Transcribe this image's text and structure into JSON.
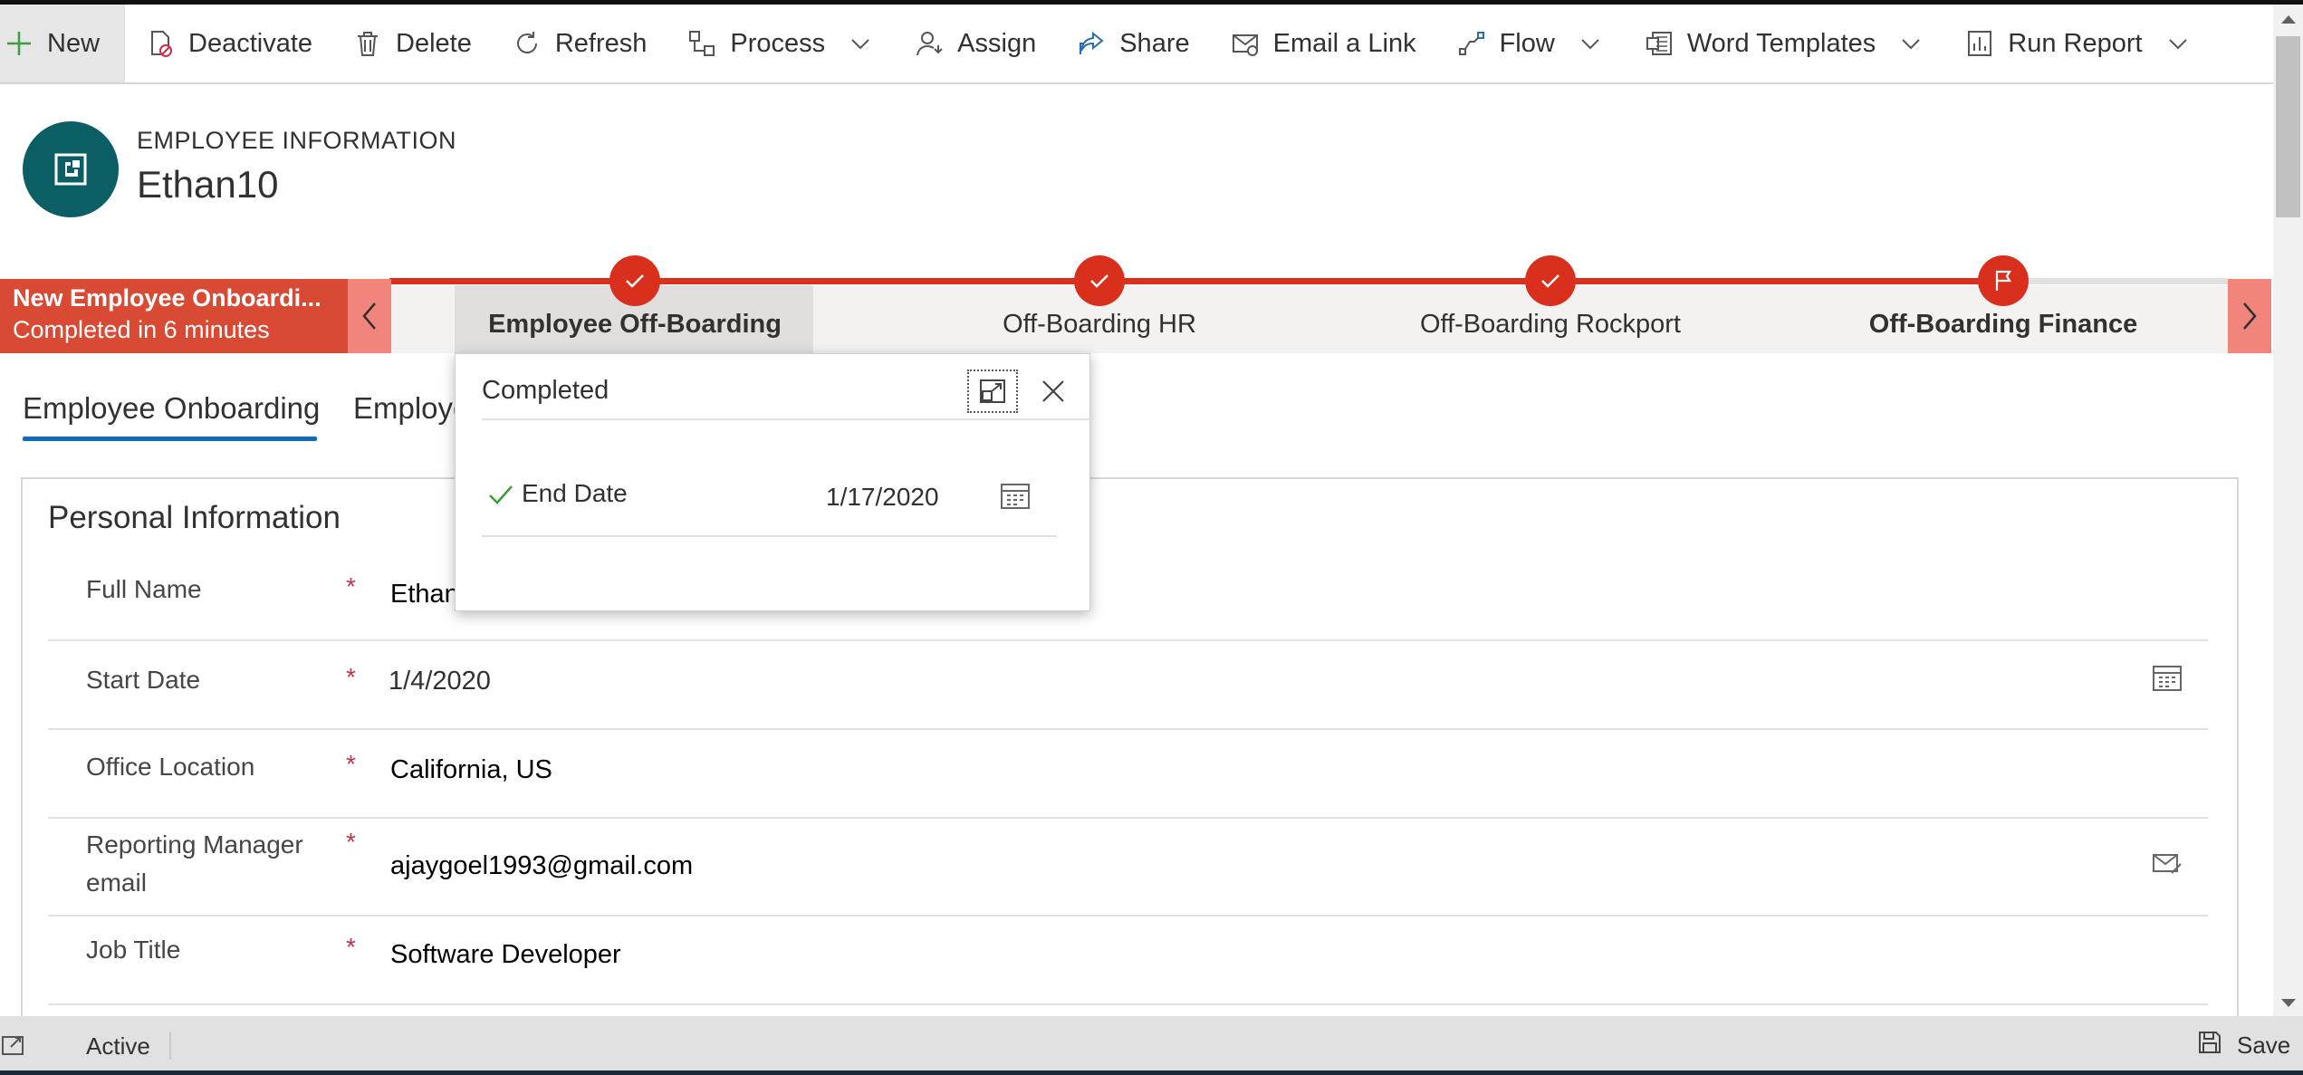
{
  "commandbar": {
    "new": "New",
    "deactivate": "Deactivate",
    "delete": "Delete",
    "refresh": "Refresh",
    "process": "Process",
    "assign": "Assign",
    "share": "Share",
    "email_link": "Email a Link",
    "flow": "Flow",
    "word_templates": "Word Templates",
    "run_report": "Run Report"
  },
  "header": {
    "entity_type": "EMPLOYEE INFORMATION",
    "record_name": "Ethan10"
  },
  "bpf": {
    "process_name": "New Employee Onboardi...",
    "process_status": "Completed in 6 minutes",
    "stages": [
      {
        "label": "Employee Off-Boarding",
        "state": "completed",
        "active": true
      },
      {
        "label": "Off-Boarding HR",
        "state": "completed",
        "active": false
      },
      {
        "label": "Off-Boarding Rockport",
        "state": "completed",
        "active": false
      },
      {
        "label": "Off-Boarding Finance",
        "state": "final",
        "active": false
      }
    ]
  },
  "stage_popup": {
    "title": "Completed",
    "field_label": "End Date",
    "field_value": "1/17/2020"
  },
  "tabs": [
    {
      "label": "Employee Onboarding",
      "selected": true
    },
    {
      "label": "Employe",
      "selected": false
    }
  ],
  "section": {
    "title": "Personal Information",
    "fields": [
      {
        "label": "Full Name",
        "required": "*",
        "value": "Ethan"
      },
      {
        "label": "Start Date",
        "required": "*",
        "value": "1/4/2020"
      },
      {
        "label": "Office Location",
        "required": "*",
        "value": "California, US"
      },
      {
        "label": "Reporting Manager",
        "label2": "email",
        "required": "*",
        "value": "ajaygoel1993@gmail.com"
      },
      {
        "label": "Job Title",
        "required": "*",
        "value": "Software Developer"
      }
    ]
  },
  "statusbar": {
    "status": "Active",
    "save": "Save"
  },
  "colors": {
    "accent_red": "#d9301e",
    "bpf_flag": "#d94a35",
    "avatar": "#0b5e63",
    "tab_underline": "#0f6cbd",
    "required": "#c4314b"
  }
}
